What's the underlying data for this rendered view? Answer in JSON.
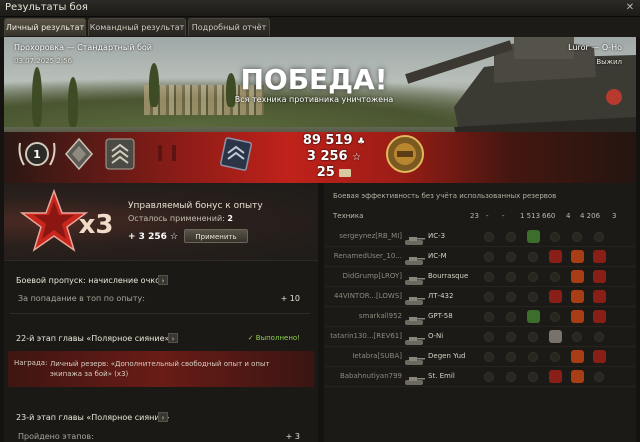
{
  "window": {
    "title": "Результаты боя",
    "close": "✕"
  },
  "tabs": [
    "Личный результат",
    "Командный результат",
    "Подробный отчёт"
  ],
  "banner": {
    "map": "Прохоровка — Стандартный бой",
    "date": "03.07.2025 2:56",
    "player": "Luror — О-Но",
    "exit": "Выжил",
    "result": "ПОБЕДА!",
    "subtitle": "Вся техника противника уничтожена",
    "rank": "1",
    "credits": "89 519",
    "xp": "3 256",
    "free_xp": "25",
    "credits_icon": "♣",
    "xp_icon": "☆"
  },
  "bonus": {
    "multiplier": "x3",
    "title": "Управляемый бонус к опыту",
    "uses_label": "Осталось применений:",
    "uses_value": "2",
    "amount": "+ 3 256 ☆",
    "apply": "Применить"
  },
  "progress": {
    "battle_pass": "Боевой пропуск: начисление очков",
    "bp_row": "За попадание в топ по опыту:",
    "bp_value": "+ 10",
    "stage22": "22-й этап главы «Полярное сияние»",
    "done": "✓ Выполнено!",
    "reward_label": "Награда:",
    "reward_text": "Личный резерв: «Дополнительный свободный опыт и опыт экипажа за бой» (x3)",
    "stage23": "23-й этап главы «Полярное сияние»",
    "stage23_row": "Пройдено этапов:",
    "stage23_value": "+ 3"
  },
  "efficiency": {
    "header": "Боевая эффективность без учёта использованных резервов",
    "col_vehicle": "Техника",
    "cols": [
      "23",
      "-",
      "-",
      "1 513",
      "660",
      "4",
      "4 206",
      "3"
    ],
    "rows": [
      {
        "player": "sergeynez[RB_MI]",
        "tank": "ИС-3"
      },
      {
        "player": "RenamedUser_10...",
        "tank": "ИС-М"
      },
      {
        "player": "DidGrump[LROY]",
        "tank": "Bourrasque"
      },
      {
        "player": "44VINTOR...[LOWS]",
        "tank": "ЛТ-432"
      },
      {
        "player": "smarkall952",
        "tank": "GPT-58"
      },
      {
        "player": "tatarin130...[REV61]",
        "tank": "О-Ni"
      },
      {
        "player": "Ietabra[SUBA]",
        "tank": "Degen Yud"
      },
      {
        "player": "Babahnutiyan799",
        "tank": "St. Emil"
      }
    ]
  },
  "colors": {
    "accent_red": "#c0221a",
    "done_green": "#8fcf4a"
  }
}
